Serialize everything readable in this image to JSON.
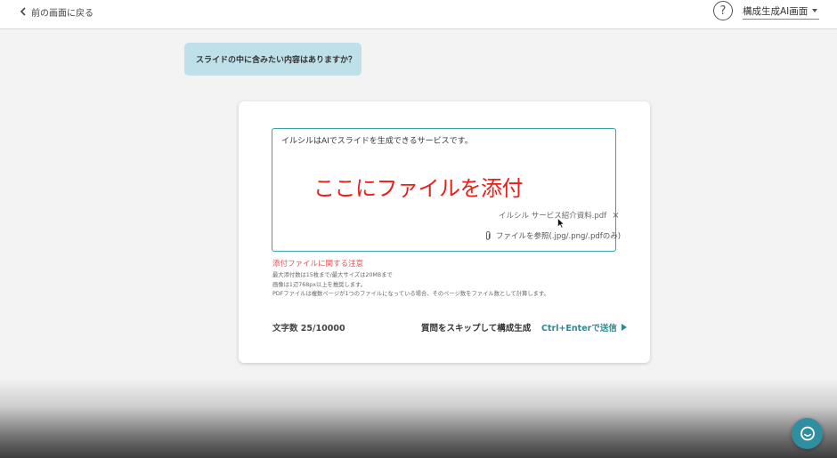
{
  "header": {
    "back_label": "前の画面に戻る",
    "help_glyph": "?",
    "mode_select_value": "構成生成AI画面"
  },
  "assistant_bubble": {
    "text": "スライドの中に含みたい内容はありますか？"
  },
  "composer": {
    "input_text": "イルシルはAIでスライドを生成できるサービスです。",
    "overlay_note": "ここにファイルを添付",
    "attached_file": {
      "name": "イルシル サービス紹介資料.pdf",
      "remove_glyph": "×"
    },
    "browse_label": "ファイルを参照(.jpg/.png/.pdfのみ)"
  },
  "notes": {
    "title": "添付ファイルに関する注意",
    "lines": [
      "最大添付数は15枚まで/最大サイズは20MBまで",
      "画像は1辺768px以上を推奨します。",
      "PDFファイルは複数ページが1つのファイルになっている場合、そのページ数をファイル数として計算します。"
    ]
  },
  "footer": {
    "char_count": "文字数 25/10000",
    "skip_label": "質問をスキップして構成生成",
    "send_label": "Ctrl+Enterで送信"
  },
  "colors": {
    "accent": "#2a8a93",
    "input_border": "#3aa3aa",
    "bubble_bg": "#bfe0e8",
    "warning": "#e05555",
    "overlay_note": "#e8201a",
    "chat_fab": "#2f8fa0"
  },
  "icons": {
    "back": "chevron-left-icon",
    "help": "question-circle-icon",
    "dropdown": "caret-down-icon",
    "remove": "close-icon",
    "attach": "paperclip-icon",
    "send": "play-triangle-icon",
    "chat": "chat-bubble-icon",
    "cursor": "mouse-pointer-icon"
  }
}
